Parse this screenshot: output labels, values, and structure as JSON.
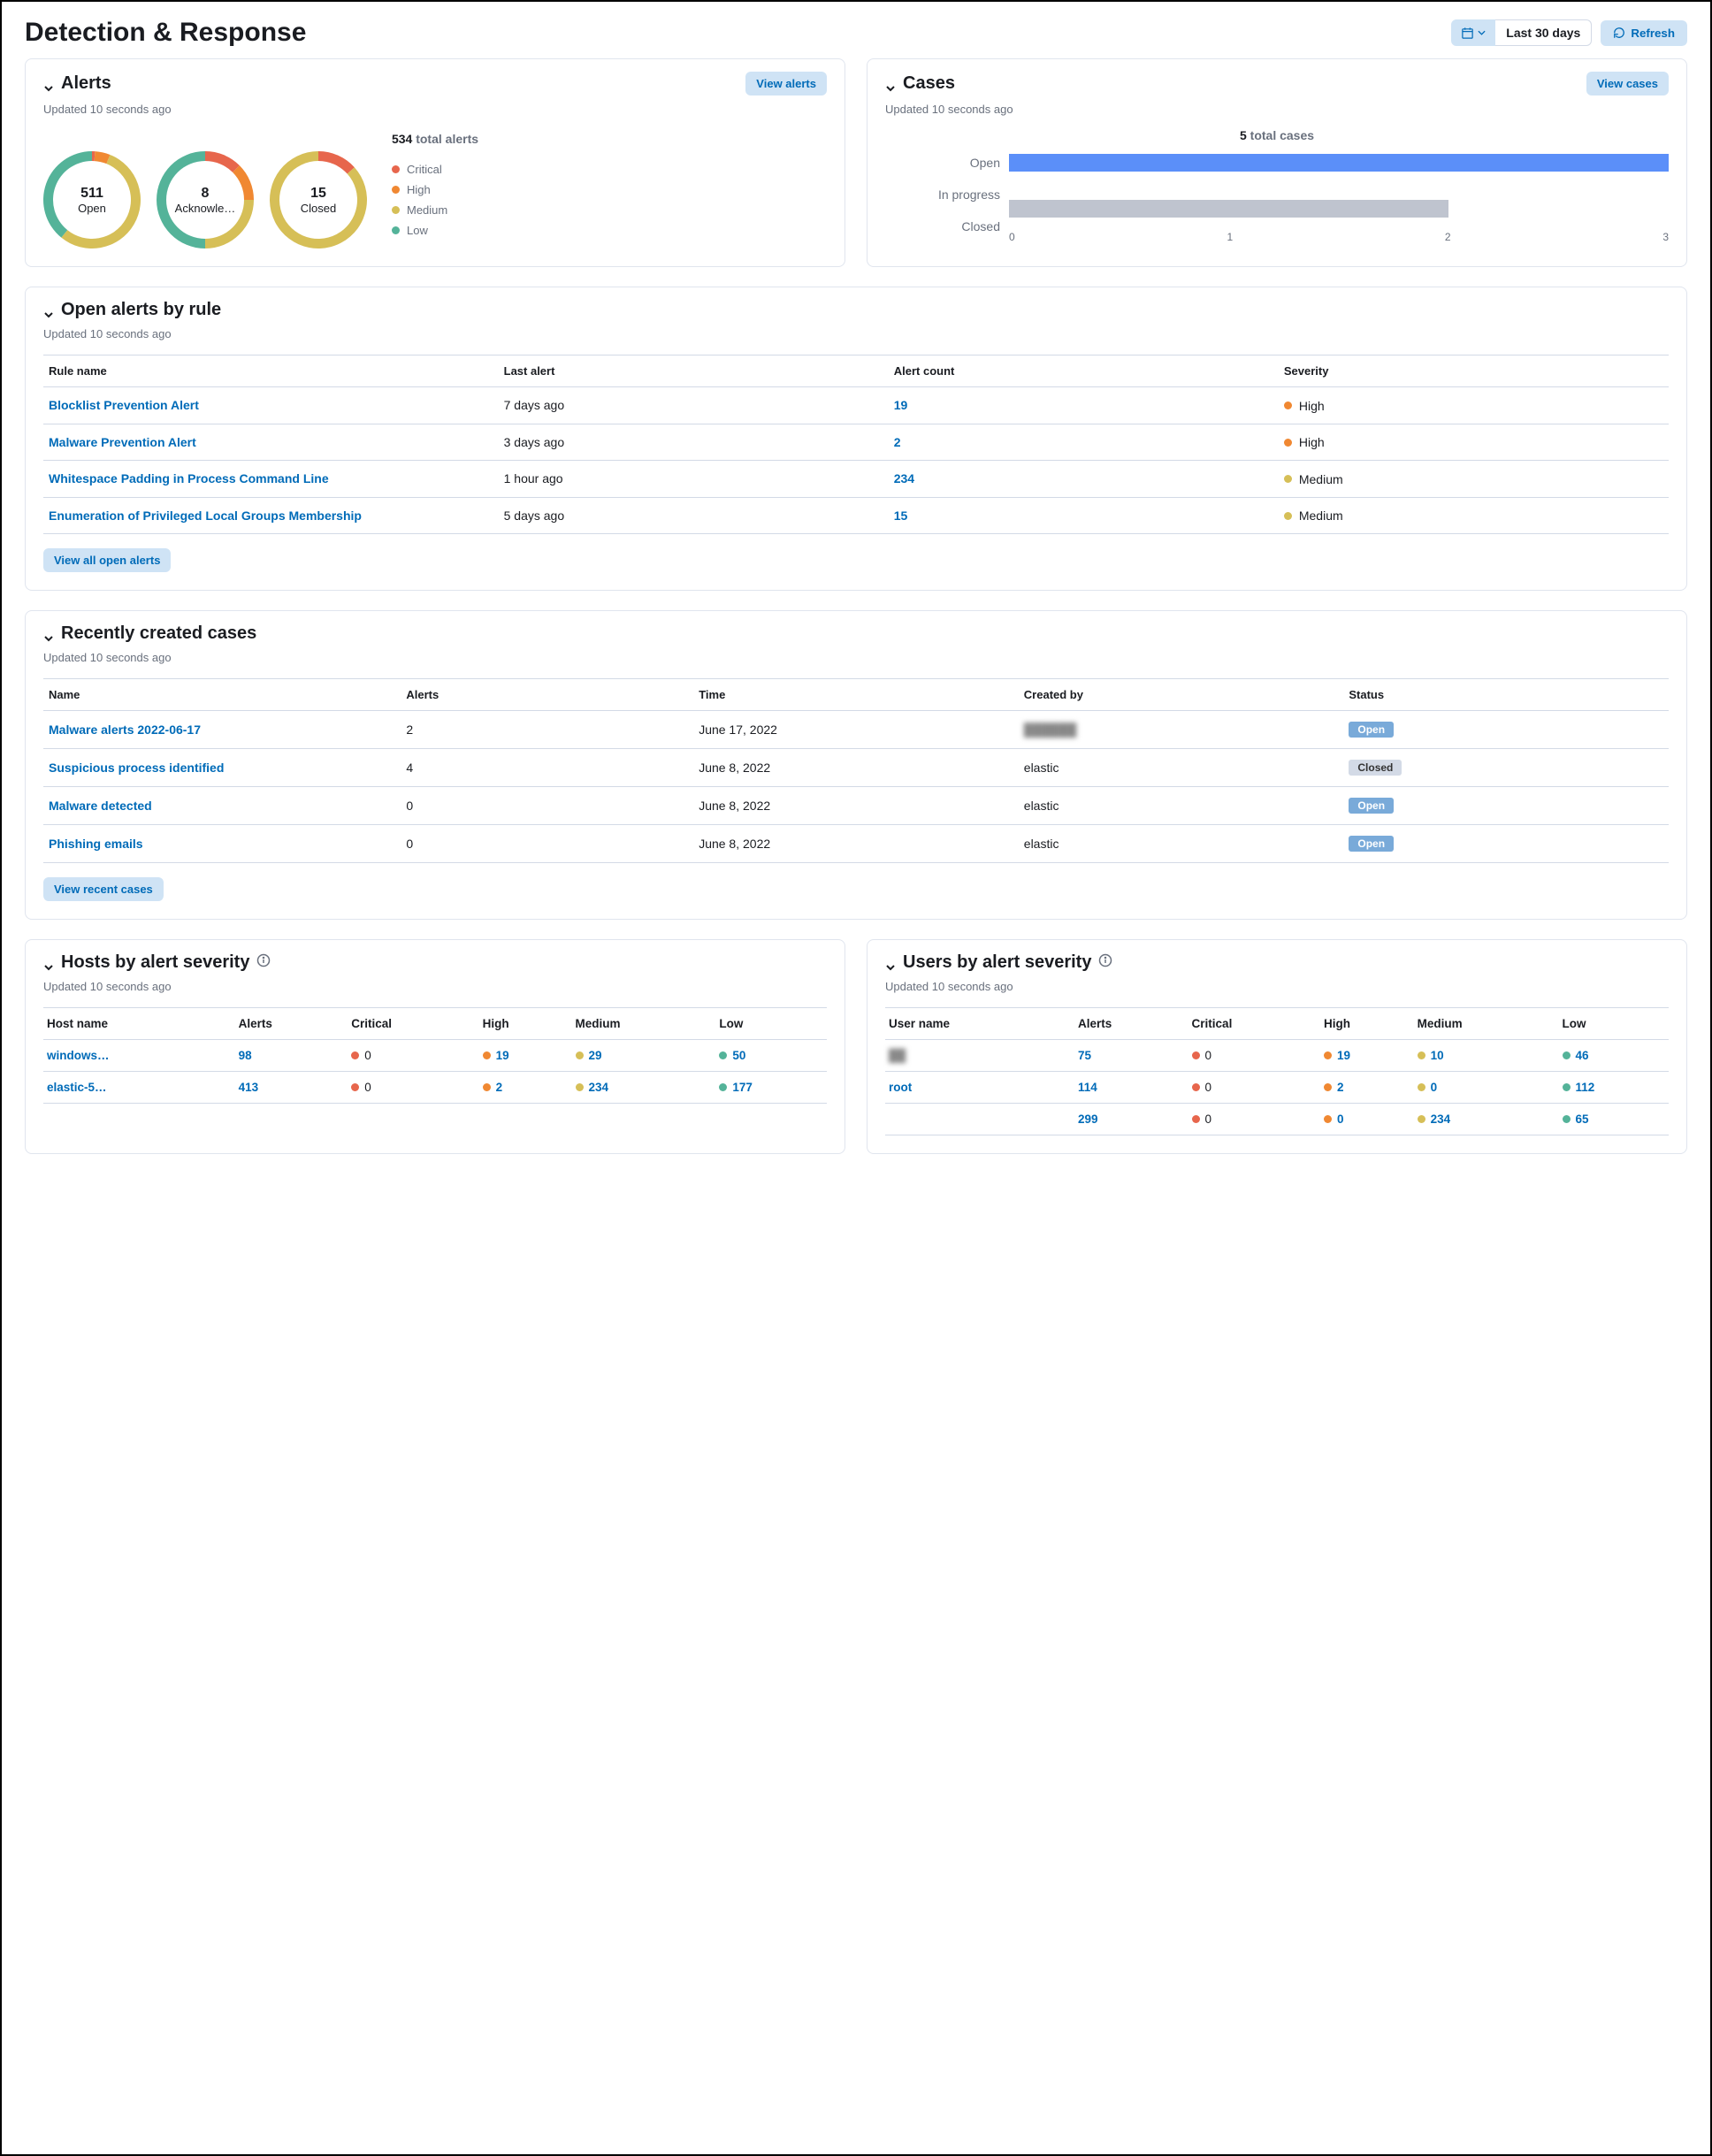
{
  "page": {
    "title": "Detection & Response",
    "date_range": "Last 30 days",
    "refresh_label": "Refresh"
  },
  "alerts_panel": {
    "title": "Alerts",
    "view_label": "View alerts",
    "updated": "Updated 10 seconds ago",
    "total_value": "534",
    "total_label": "total alerts",
    "legend": {
      "critical": "Critical",
      "high": "High",
      "medium": "Medium",
      "low": "Low"
    },
    "donuts": [
      {
        "value": "511",
        "label": "Open"
      },
      {
        "value": "8",
        "label": "Acknowle…"
      },
      {
        "value": "15",
        "label": "Closed"
      }
    ]
  },
  "cases_panel": {
    "title": "Cases",
    "view_label": "View cases",
    "updated": "Updated 10 seconds ago",
    "total_value": "5",
    "total_label": "total cases",
    "rows": [
      {
        "label": "Open",
        "value": 3,
        "color": "blue"
      },
      {
        "label": "In progress",
        "value": 0
      },
      {
        "label": "Closed",
        "value": 2,
        "color": "grey"
      }
    ],
    "axis": [
      "0",
      "1",
      "2",
      "3"
    ],
    "axis_max": 3
  },
  "open_alerts_by_rule": {
    "title": "Open alerts by rule",
    "updated": "Updated 10 seconds ago",
    "columns": {
      "rule": "Rule name",
      "last": "Last alert",
      "count": "Alert count",
      "sev": "Severity"
    },
    "rows": [
      {
        "rule": "Blocklist Prevention Alert",
        "last": "7 days ago",
        "count": "19",
        "sev": "High",
        "sev_color": "high"
      },
      {
        "rule": "Malware Prevention Alert",
        "last": "3 days ago",
        "count": "2",
        "sev": "High",
        "sev_color": "high"
      },
      {
        "rule": "Whitespace Padding in Process Command Line",
        "last": "1 hour ago",
        "count": "234",
        "sev": "Medium",
        "sev_color": "med"
      },
      {
        "rule": "Enumeration of Privileged Local Groups Membership",
        "last": "5 days ago",
        "count": "15",
        "sev": "Medium",
        "sev_color": "med"
      }
    ],
    "view_all_label": "View all open alerts"
  },
  "recent_cases": {
    "title": "Recently created cases",
    "updated": "Updated 10 seconds ago",
    "columns": {
      "name": "Name",
      "alerts": "Alerts",
      "time": "Time",
      "by": "Created by",
      "status": "Status"
    },
    "rows": [
      {
        "name": "Malware alerts 2022-06-17",
        "alerts": "2",
        "time": "June 17, 2022",
        "by": "██████",
        "by_redacted": true,
        "status": "Open"
      },
      {
        "name": "Suspicious process identified",
        "alerts": "4",
        "time": "June 8, 2022",
        "by": "elastic",
        "status": "Closed"
      },
      {
        "name": "Malware detected",
        "alerts": "0",
        "time": "June 8, 2022",
        "by": "elastic",
        "status": "Open"
      },
      {
        "name": "Phishing emails",
        "alerts": "0",
        "time": "June 8, 2022",
        "by": "elastic",
        "status": "Open"
      }
    ],
    "view_all_label": "View recent cases"
  },
  "hosts_panel": {
    "title": "Hosts by alert severity",
    "updated": "Updated 10 seconds ago",
    "columns": {
      "name": "Host name",
      "alerts": "Alerts",
      "crit": "Critical",
      "high": "High",
      "med": "Medium",
      "low": "Low"
    },
    "rows": [
      {
        "name": "windows…",
        "alerts": "98",
        "crit": "0",
        "high": "19",
        "med": "29",
        "low": "50"
      },
      {
        "name": "elastic-5…",
        "alerts": "413",
        "crit": "0",
        "high": "2",
        "med": "234",
        "low": "177"
      }
    ]
  },
  "users_panel": {
    "title": "Users by alert severity",
    "updated": "Updated 10 seconds ago",
    "columns": {
      "name": "User name",
      "alerts": "Alerts",
      "crit": "Critical",
      "high": "High",
      "med": "Medium",
      "low": "Low"
    },
    "rows": [
      {
        "name": "██",
        "name_redacted": true,
        "alerts": "75",
        "crit": "0",
        "high": "19",
        "med": "10",
        "low": "46"
      },
      {
        "name": "root",
        "alerts": "114",
        "crit": "0",
        "high": "2",
        "med": "0",
        "low": "112"
      },
      {
        "name": "",
        "alerts": "299",
        "crit": "0",
        "high": "0",
        "med": "234",
        "low": "65"
      }
    ]
  },
  "chart_data": [
    {
      "type": "bar",
      "title": "Cases by status",
      "orientation": "horizontal",
      "categories": [
        "Open",
        "In progress",
        "Closed"
      ],
      "values": [
        3,
        0,
        2
      ],
      "xlabel": "",
      "ylabel": "",
      "xlim": [
        0,
        3
      ]
    },
    {
      "type": "pie",
      "title": "Open alerts by severity",
      "total": 511,
      "series": [
        {
          "name": "Critical",
          "value": 5,
          "color": "#e7664c"
        },
        {
          "name": "High",
          "value": 26,
          "color": "#f08832"
        },
        {
          "name": "Medium",
          "value": 280,
          "color": "#d6bf57"
        },
        {
          "name": "Low",
          "value": 200,
          "color": "#54b399"
        }
      ]
    },
    {
      "type": "pie",
      "title": "Acknowledged alerts by severity",
      "total": 8,
      "series": [
        {
          "name": "Critical",
          "value": 1,
          "color": "#e7664c"
        },
        {
          "name": "High",
          "value": 1,
          "color": "#f08832"
        },
        {
          "name": "Medium",
          "value": 2,
          "color": "#d6bf57"
        },
        {
          "name": "Low",
          "value": 4,
          "color": "#54b399"
        }
      ]
    },
    {
      "type": "pie",
      "title": "Closed alerts by severity",
      "total": 15,
      "series": [
        {
          "name": "Critical",
          "value": 2,
          "color": "#e7664c"
        },
        {
          "name": "High",
          "value": 0,
          "color": "#f08832"
        },
        {
          "name": "Medium",
          "value": 13,
          "color": "#d6bf57"
        },
        {
          "name": "Low",
          "value": 0,
          "color": "#54b399"
        }
      ]
    }
  ]
}
